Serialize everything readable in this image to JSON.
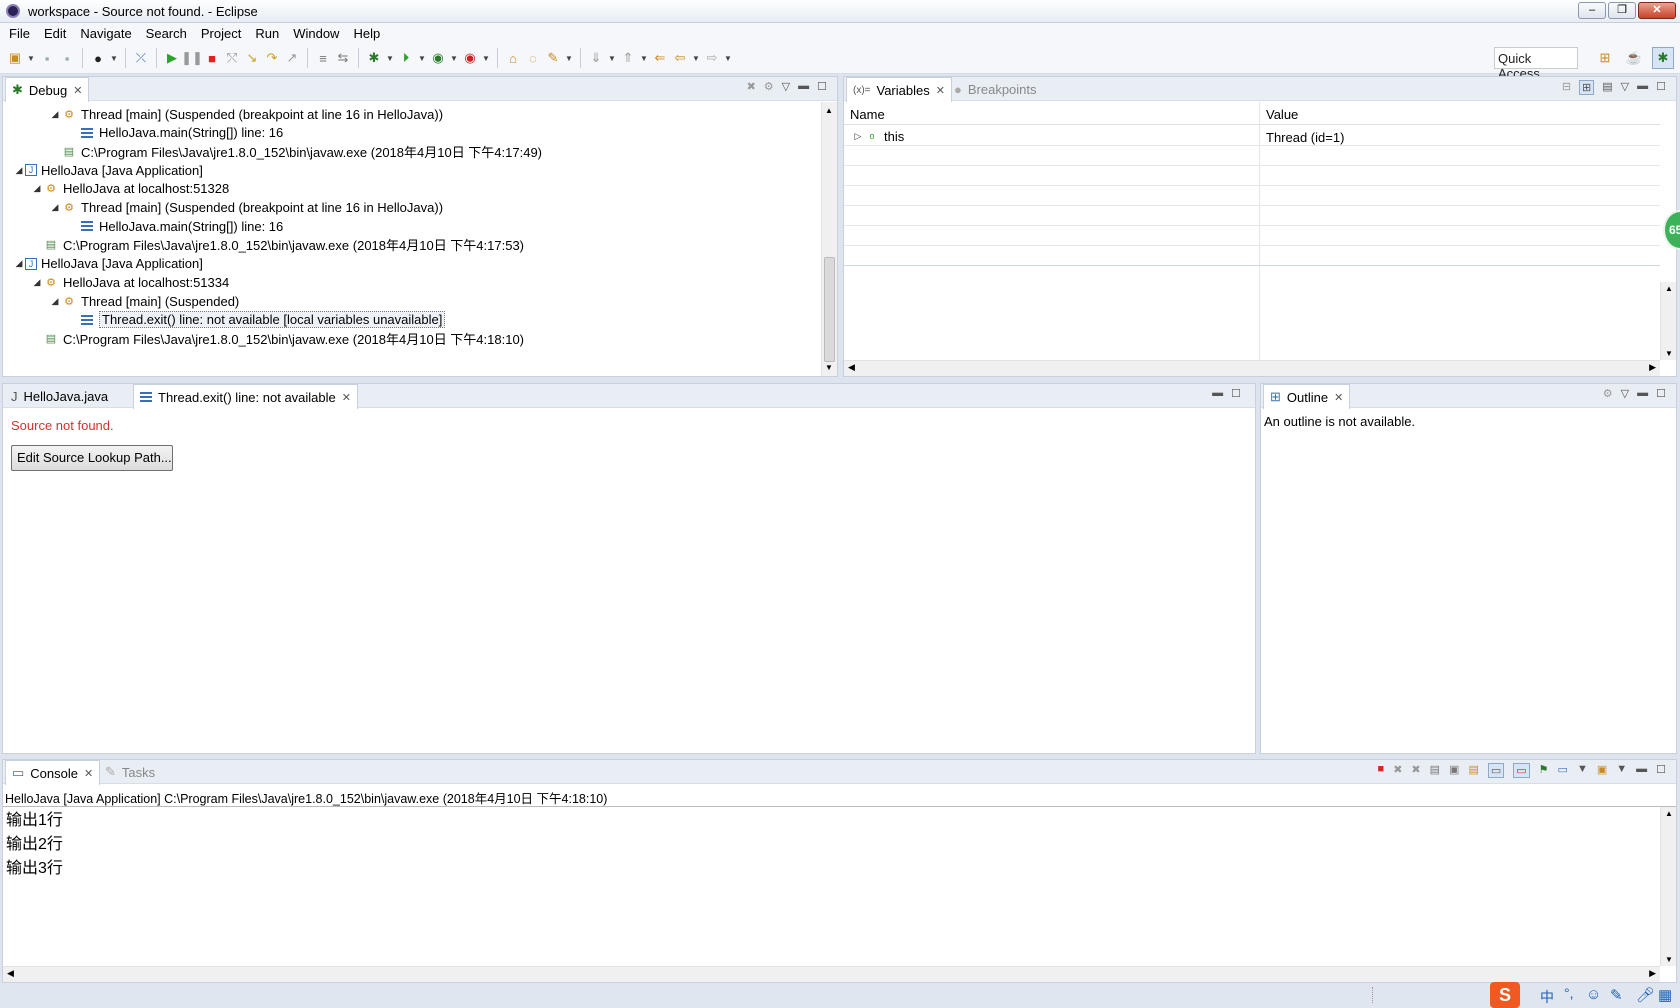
{
  "window": {
    "title": "workspace - Source not found. - Eclipse",
    "min": "‒",
    "max": "❐",
    "close": "✕"
  },
  "menu": [
    "File",
    "Edit",
    "Navigate",
    "Search",
    "Project",
    "Run",
    "Window",
    "Help"
  ],
  "toolbar": {
    "quick_access": "Quick Access"
  },
  "debug": {
    "tab": "Debug",
    "rows": [
      {
        "text": "Thread [main] (Suspended (breakpoint at line 16 in HelloJava))",
        "icon": "thread-suspended-icon"
      },
      {
        "text": "HelloJava.main(String[]) line: 16",
        "icon": "stack-frame-icon"
      },
      {
        "text": "C:\\Program Files\\Java\\jre1.8.0_152\\bin\\javaw.exe (2018年4月10日 下午4:17:49)",
        "icon": "process-icon"
      },
      {
        "text": "HelloJava [Java Application]",
        "icon": "java-app-icon"
      },
      {
        "text": "HelloJava at localhost:51328",
        "icon": "debug-target-icon"
      },
      {
        "text": "Thread [main] (Suspended (breakpoint at line 16 in HelloJava))",
        "icon": "thread-suspended-icon"
      },
      {
        "text": "HelloJava.main(String[]) line: 16",
        "icon": "stack-frame-icon"
      },
      {
        "text": "C:\\Program Files\\Java\\jre1.8.0_152\\bin\\javaw.exe (2018年4月10日 下午4:17:53)",
        "icon": "process-icon"
      },
      {
        "text": "HelloJava [Java Application]",
        "icon": "java-app-icon"
      },
      {
        "text": "HelloJava at localhost:51334",
        "icon": "debug-target-icon"
      },
      {
        "text": "Thread [main] (Suspended)",
        "icon": "thread-suspended-icon"
      },
      {
        "text": "Thread.exit() line: not available [local variables unavailable]",
        "icon": "stack-frame-icon"
      },
      {
        "text": "C:\\Program Files\\Java\\jre1.8.0_152\\bin\\javaw.exe (2018年4月10日 下午4:18:10)",
        "icon": "process-icon"
      }
    ]
  },
  "variables": {
    "tab": "Variables",
    "tab_prefix": "(x)=",
    "tab2": "Breakpoints",
    "col_name": "Name",
    "col_value": "Value",
    "rows": [
      {
        "name": "this",
        "value": "Thread  (id=1)"
      }
    ]
  },
  "editor": {
    "tab1": "HelloJava.java",
    "tab2": "Thread.exit() line: not available",
    "message": "Source not found.",
    "button": "Edit Source Lookup Path..."
  },
  "outline": {
    "tab": "Outline",
    "message": "An outline is not available."
  },
  "console": {
    "tab": "Console",
    "tab2": "Tasks",
    "header": "HelloJava [Java Application] C:\\Program Files\\Java\\jre1.8.0_152\\bin\\javaw.exe (2018年4月10日 下午4:18:10)",
    "lines": [
      "输出1行",
      "输出2行",
      "输出3行"
    ]
  },
  "badge": "65",
  "taskbar": {
    "ime": "中",
    "punct": "°,"
  }
}
